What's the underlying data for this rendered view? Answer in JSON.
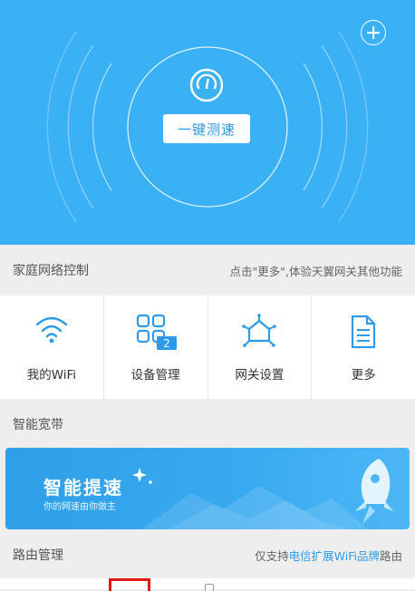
{
  "hero": {
    "speed_button_label": "一键测速",
    "background_color": "#3ab0f5",
    "plus_icon": "plus-circle-icon",
    "gauge_icon": "speedometer-icon"
  },
  "home_network": {
    "title": "家庭网络控制",
    "hint": "点击\"更多\",体验天翼网关其他功能",
    "items": [
      {
        "label": "我的WiFi",
        "icon": "wifi-icon"
      },
      {
        "label": "设备管理",
        "icon": "device-grid-icon",
        "badge": "2"
      },
      {
        "label": "网关设置",
        "icon": "gateway-settings-icon"
      },
      {
        "label": "更多",
        "icon": "document-icon"
      }
    ]
  },
  "smart_broadband": {
    "title": "智能宽带",
    "banner_title": "智能提速",
    "banner_subtitle": "你的网速由你做主",
    "banner_icon": "rocket-icon"
  },
  "router_management": {
    "title": "路由管理",
    "hint_prefix": "仅支持",
    "hint_highlight": "电信扩展WiFi品牌",
    "hint_suffix": "路由"
  },
  "colors": {
    "accent": "#2c9ae8",
    "highlight_box": "#e01818"
  }
}
